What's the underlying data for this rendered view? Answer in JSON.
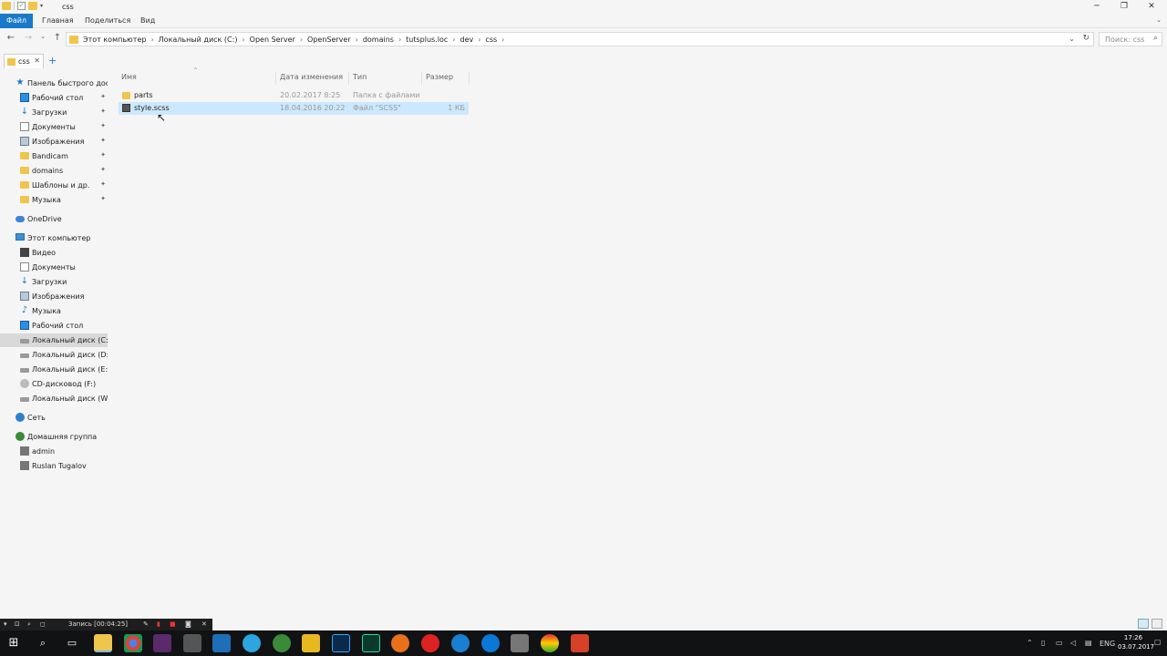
{
  "window": {
    "title": "css",
    "minimize_glyph": "─",
    "restore_glyph": "❐",
    "close_glyph": "✕"
  },
  "ribbon": {
    "tabs": [
      "Файл",
      "Главная",
      "Поделиться",
      "Вид"
    ]
  },
  "address": {
    "crumbs": [
      "Этот компьютер",
      "Локальный диск (C:)",
      "Open Server",
      "OpenServer",
      "domains",
      "tutsplus.loc",
      "dev",
      "css"
    ],
    "search_placeholder": "Поиск: css"
  },
  "tabs": {
    "current": "css"
  },
  "sidebar": {
    "quick_access": "Панель быстрого доступа",
    "pinned": [
      {
        "label": "Рабочий стол",
        "icon": "desktop-icon"
      },
      {
        "label": "Загрузки",
        "icon": "downloads-icon"
      },
      {
        "label": "Документы",
        "icon": "documents-icon"
      },
      {
        "label": "Изображения",
        "icon": "pictures-icon"
      },
      {
        "label": "Bandicam",
        "icon": "folder-icon"
      },
      {
        "label": "domains",
        "icon": "folder-icon"
      },
      {
        "label": "Шаблоны и др.",
        "icon": "folder-icon"
      },
      {
        "label": "Музыка",
        "icon": "folder-icon"
      }
    ],
    "onedrive": "OneDrive",
    "this_pc": "Этот компьютер",
    "pc_items": [
      {
        "label": "Видео",
        "icon": "video-icon"
      },
      {
        "label": "Документы",
        "icon": "documents-icon"
      },
      {
        "label": "Загрузки",
        "icon": "downloads-icon"
      },
      {
        "label": "Изображения",
        "icon": "pictures-icon"
      },
      {
        "label": "Музыка",
        "icon": "music-icon"
      },
      {
        "label": "Рабочий стол",
        "icon": "desktop-icon"
      },
      {
        "label": "Локальный диск (C:)",
        "icon": "disk-icon"
      },
      {
        "label": "Локальный диск (D:)",
        "icon": "disk-icon"
      },
      {
        "label": "Локальный диск (E:)",
        "icon": "disk-icon"
      },
      {
        "label": "CD-дисковод (F:)",
        "icon": "cd-icon"
      },
      {
        "label": "Локальный диск (W:)",
        "icon": "disk-icon"
      }
    ],
    "network": "Сеть",
    "homegroup": "Домашняя группа",
    "homegroup_items": [
      "admin",
      "Ruslan Tugalov"
    ]
  },
  "columns": {
    "name": "Имя",
    "date": "Дата изменения",
    "type": "Тип",
    "size": "Размер"
  },
  "files": [
    {
      "name": "parts",
      "date": "20.02.2017 8:25",
      "type": "Папка с файлами",
      "size": ""
    },
    {
      "name": "style.scss",
      "date": "18.04.2016 20:22",
      "type": "Файл \"SCSS\"",
      "size": "1 КБ"
    }
  ],
  "recording": {
    "label": "Запись [00:04:25]"
  },
  "taskbar": {
    "language": "ENG",
    "time": "17:26",
    "date": "03.07.2017"
  },
  "colors": {
    "file_tab": "#1979ca",
    "selection": "#cce8ff",
    "taskbar": "#101214"
  }
}
